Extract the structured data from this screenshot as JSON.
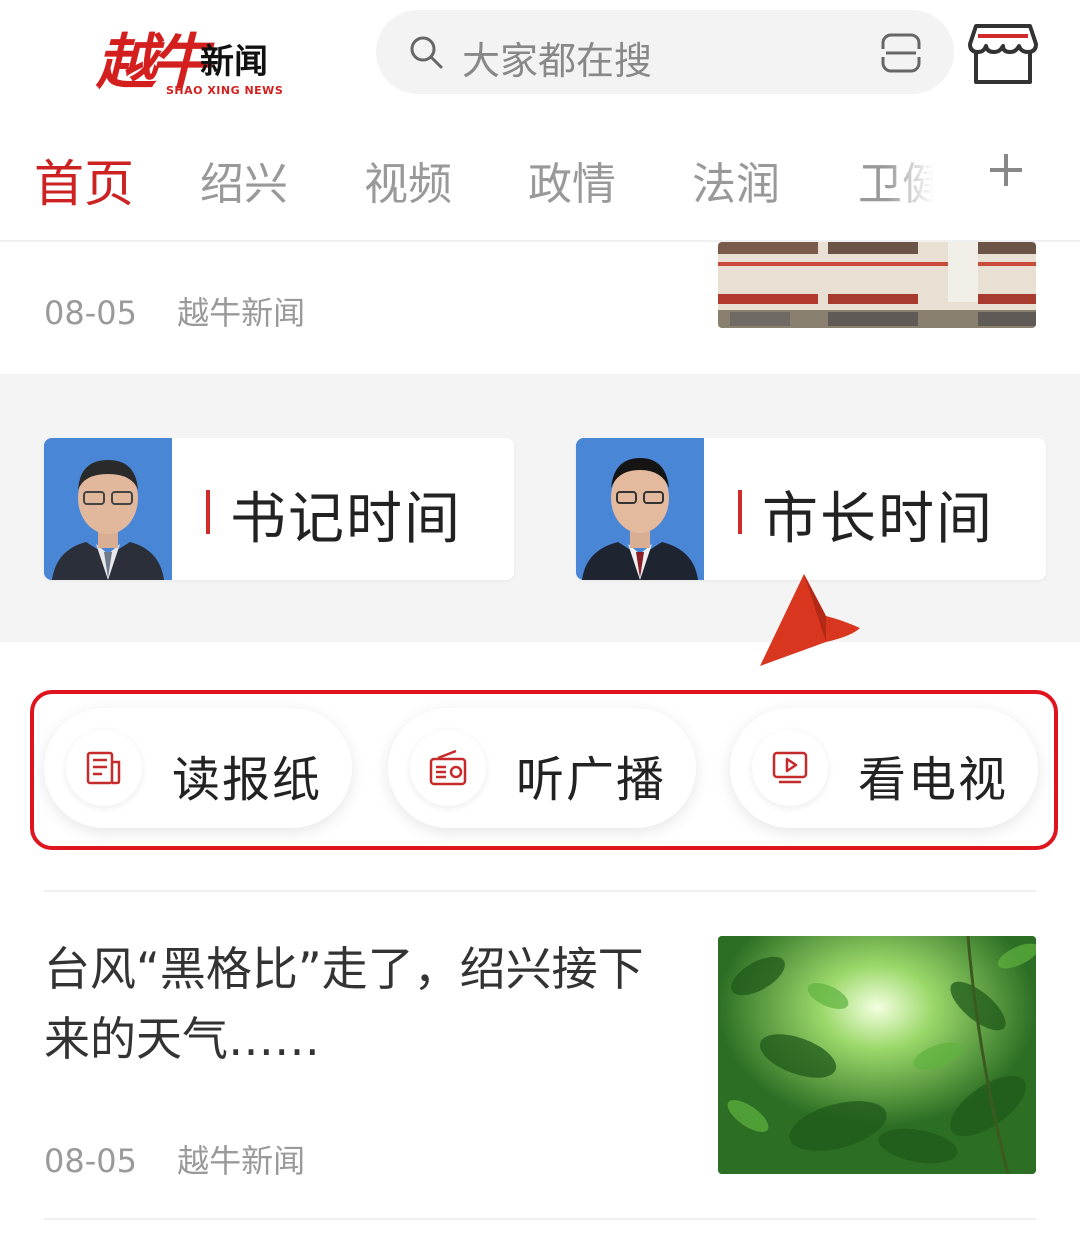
{
  "header": {
    "logo_mark": "越牛",
    "logo_word": "新闻",
    "logo_sub": "SHAO XING NEWS",
    "search_placeholder": "大家都在搜"
  },
  "tabs": [
    {
      "label": "首页",
      "active": true
    },
    {
      "label": "绍兴"
    },
    {
      "label": "视频"
    },
    {
      "label": "政情"
    },
    {
      "label": "法润"
    },
    {
      "label": "卫健"
    }
  ],
  "news_top": {
    "date": "08-05",
    "source": "越牛新闻"
  },
  "leaders": [
    {
      "label": "书记时间"
    },
    {
      "label": "市长时间"
    }
  ],
  "media": [
    {
      "label": "读报纸",
      "icon": "newspaper-icon"
    },
    {
      "label": "听广播",
      "icon": "radio-icon"
    },
    {
      "label": "看电视",
      "icon": "tv-icon"
    }
  ],
  "news_bottom": {
    "title": "台风“黑格比”走了，绍兴接下来的天气……",
    "date": "08-05",
    "source": "越牛新闻"
  },
  "colors": {
    "brand_red": "#cc2222",
    "highlight_border": "#e0141e",
    "pointer": "#d9361f"
  }
}
